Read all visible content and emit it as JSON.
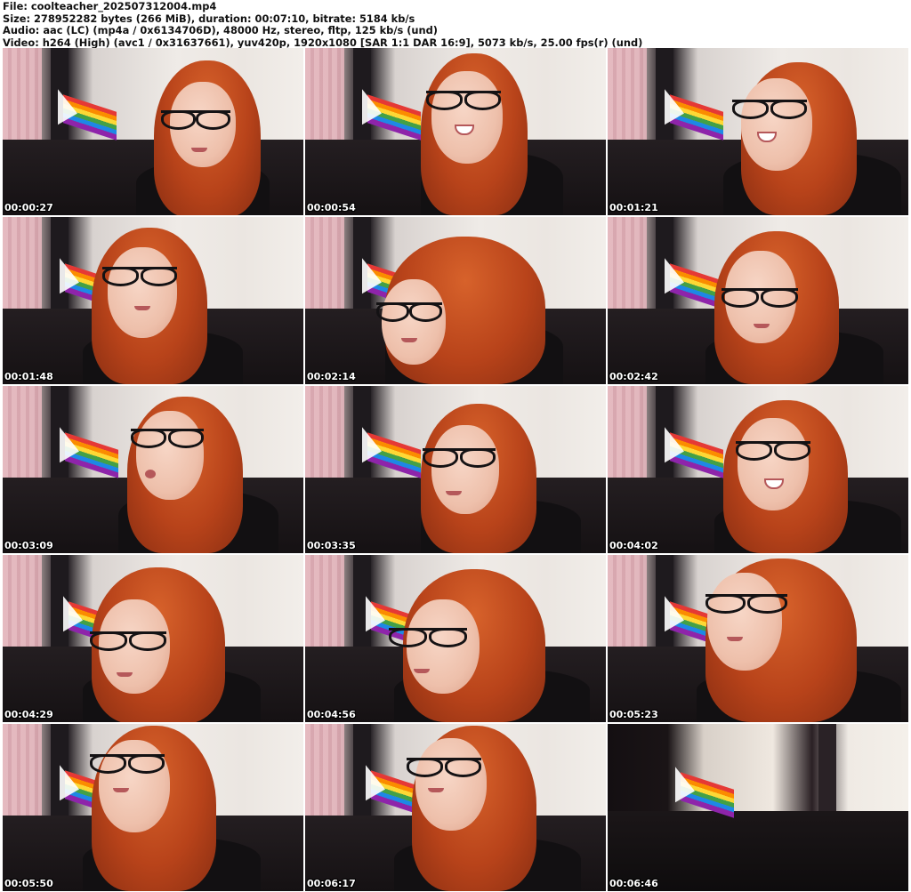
{
  "header": {
    "file_line": "File: coolteacher_202507312004.mp4",
    "size_line": "Size: 278952282 bytes (266 MiB), duration: 00:07:10, bitrate: 5184 kb/s",
    "audio_line": "Audio: aac (LC) (mp4a / 0x6134706D), 48000 Hz, stereo, fltp, 125 kb/s (und)",
    "video_line": "Video: h264 (High) (avc1 / 0x31637661), yuv420p, 1920x1080 [SAR 1:1 DAR 16:9], 5073 kb/s, 25.00 fps(r) (und)"
  },
  "thumbnails": [
    {
      "timestamp": "00:00:27"
    },
    {
      "timestamp": "00:00:54"
    },
    {
      "timestamp": "00:01:21"
    },
    {
      "timestamp": "00:01:48"
    },
    {
      "timestamp": "00:02:14"
    },
    {
      "timestamp": "00:02:42"
    },
    {
      "timestamp": "00:03:09"
    },
    {
      "timestamp": "00:03:35"
    },
    {
      "timestamp": "00:04:02"
    },
    {
      "timestamp": "00:04:29"
    },
    {
      "timestamp": "00:04:56"
    },
    {
      "timestamp": "00:05:23"
    },
    {
      "timestamp": "00:05:50"
    },
    {
      "timestamp": "00:06:17"
    },
    {
      "timestamp": "00:06:46"
    }
  ],
  "colors": {
    "background": "#ffffff",
    "header_text": "#111111",
    "timestamp_text": "#ffffff",
    "hair": "#b8431a"
  }
}
